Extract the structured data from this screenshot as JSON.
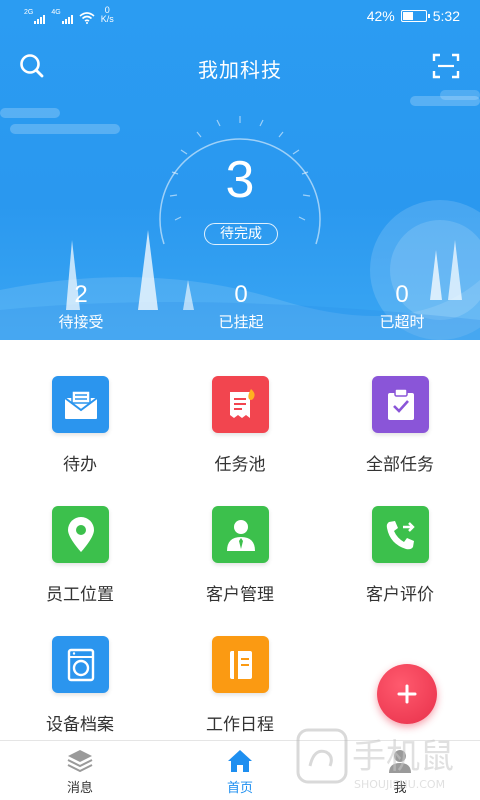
{
  "status_bar": {
    "sim1": "2G",
    "sim2": "4G",
    "speed_value": "0",
    "speed_unit": "K/s",
    "battery": "42%",
    "time": "5:32"
  },
  "header": {
    "title": "我加科技"
  },
  "gauge": {
    "value": "3",
    "label": "待完成"
  },
  "stats": [
    {
      "value": "2",
      "label": "待接受"
    },
    {
      "value": "0",
      "label": "已挂起"
    },
    {
      "value": "0",
      "label": "已超时"
    }
  ],
  "grid": [
    {
      "label": "待办",
      "icon": "mail-icon",
      "color": "#2b95ee"
    },
    {
      "label": "任务池",
      "icon": "task-pool-icon",
      "color": "#f2454f"
    },
    {
      "label": "全部任务",
      "icon": "clipboard-check-icon",
      "color": "#8a55d8"
    },
    {
      "label": "员工位置",
      "icon": "location-pin-icon",
      "color": "#3cc04c"
    },
    {
      "label": "客户管理",
      "icon": "customer-icon",
      "color": "#3cc04c"
    },
    {
      "label": "客户评价",
      "icon": "phone-transfer-icon",
      "color": "#3cc04c"
    },
    {
      "label": "设备档案",
      "icon": "washing-machine-icon",
      "color": "#2b95ee"
    },
    {
      "label": "工作日程",
      "icon": "schedule-icon",
      "color": "#fb9a12"
    }
  ],
  "nav": [
    {
      "label": "消息",
      "icon": "layers-icon"
    },
    {
      "label": "首页",
      "icon": "home-icon"
    },
    {
      "label": "我",
      "icon": "user-icon"
    }
  ],
  "watermark": {
    "text": "手机鼠",
    "sub": "SHOUJISHU.COM"
  },
  "colors": {
    "primary": "#2b9cf2",
    "fab": "#e8304a",
    "active_tab": "#1e8ff0"
  }
}
